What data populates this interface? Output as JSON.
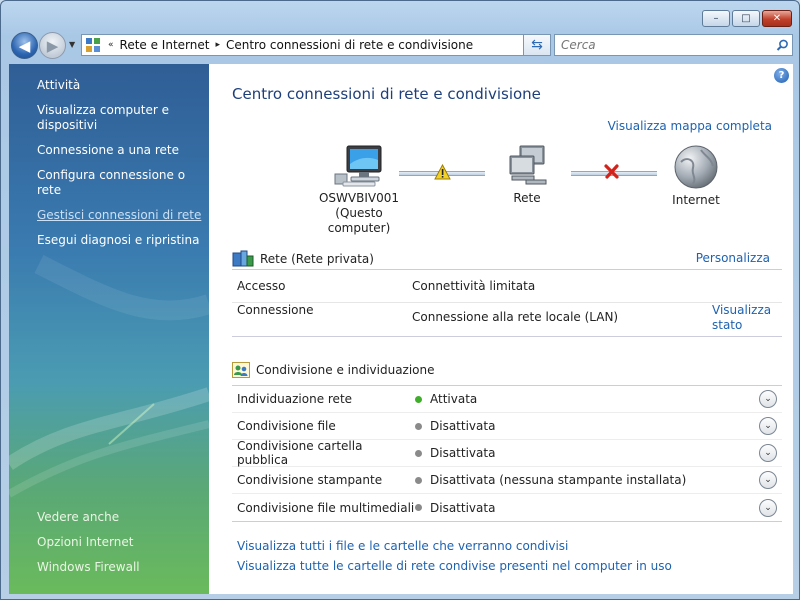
{
  "window": {
    "minimize": "–",
    "maximize": "□",
    "close": "✕"
  },
  "nav": {
    "breadcrumb_prefix": "«",
    "breadcrumb": [
      "Rete e Internet",
      "Centro connessioni di rete e condivisione"
    ],
    "breadcrumb_sep": "▸",
    "search_placeholder": "Cerca"
  },
  "sidebar": {
    "heading": "Attività",
    "items": [
      {
        "label": "Visualizza computer e dispositivi"
      },
      {
        "label": "Connessione a una rete"
      },
      {
        "label": "Configura connessione o rete"
      },
      {
        "label": "Gestisci connessioni di rete"
      },
      {
        "label": "Esegui diagnosi e ripristina"
      }
    ],
    "see_also_heading": "Vedere anche",
    "see_also": [
      {
        "label": "Opzioni Internet"
      },
      {
        "label": "Windows Firewall"
      }
    ]
  },
  "main": {
    "title": "Centro connessioni di rete e condivisione",
    "map_link": "Visualizza mappa completa",
    "map": {
      "computer_name": "OSWVBIV001",
      "computer_sub": "(Questo computer)",
      "network": "Rete",
      "internet": "Internet"
    },
    "network_section": {
      "title": "Rete (Rete privata)",
      "customize": "Personalizza",
      "rows": [
        {
          "key": "Accesso",
          "value": "Connettività limitata"
        },
        {
          "key": "Connessione",
          "value": "Connessione alla rete locale (LAN)",
          "action": "Visualizza stato"
        }
      ]
    },
    "sharing_section": {
      "title": "Condivisione e individuazione",
      "rows": [
        {
          "name": "Individuazione rete",
          "status": "Attivata",
          "dot_color": "#3fae2a"
        },
        {
          "name": "Condivisione file",
          "status": "Disattivata",
          "dot_color": "#8a8a8a"
        },
        {
          "name": "Condivisione cartella pubblica",
          "status": "Disattivata",
          "dot_color": "#8a8a8a"
        },
        {
          "name": "Condivisione stampante",
          "status": "Disattivata (nessuna stampante installata)",
          "dot_color": "#8a8a8a"
        },
        {
          "name": "Condivisione file multimediali",
          "status": "Disattivata",
          "dot_color": "#8a8a8a"
        }
      ]
    },
    "bottom_links": [
      "Visualizza tutti i file e le cartelle che verranno condivisi",
      "Visualizza tutte le cartelle di rete condivise presenti nel computer in uso"
    ]
  }
}
